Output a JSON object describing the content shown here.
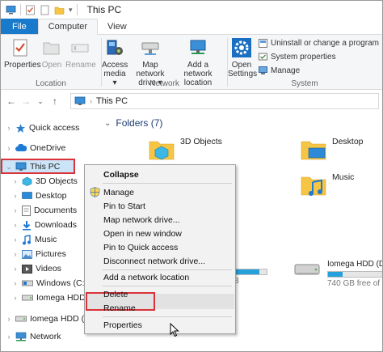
{
  "window": {
    "title": "This PC"
  },
  "tabs": [
    {
      "label": "File"
    },
    {
      "label": "Computer"
    },
    {
      "label": "View"
    }
  ],
  "ribbon": {
    "location": {
      "label": "Location",
      "buttons": [
        {
          "label": "Properties",
          "icon": "properties-icon"
        },
        {
          "label": "Open",
          "icon": "open-icon"
        },
        {
          "label": "Rename",
          "icon": "rename-icon"
        }
      ]
    },
    "network": {
      "label": "Network",
      "buttons": [
        {
          "line1": "Access",
          "line2": "media ▾",
          "icon": "access-media-icon"
        },
        {
          "line1": "Map network",
          "line2": "drive ▾",
          "icon": "map-network-drive-icon"
        },
        {
          "line1": "Add a network",
          "line2": "location",
          "icon": "add-network-location-icon"
        }
      ]
    },
    "system": {
      "label": "System",
      "open_settings": {
        "line1": "Open",
        "line2": "Settings"
      },
      "items": [
        {
          "label": "Uninstall or change a program"
        },
        {
          "label": "System properties"
        },
        {
          "label": "Manage"
        }
      ]
    }
  },
  "address": {
    "path": "This PC"
  },
  "nav": {
    "items": [
      {
        "label": "Quick access"
      },
      {
        "label": "OneDrive"
      },
      {
        "label": "This PC"
      },
      {
        "label": "3D Objects"
      },
      {
        "label": "Desktop"
      },
      {
        "label": "Documents"
      },
      {
        "label": "Downloads"
      },
      {
        "label": "Music"
      },
      {
        "label": "Pictures"
      },
      {
        "label": "Videos"
      },
      {
        "label": "Windows (C:)"
      },
      {
        "label": "Iomega HDD (D:"
      },
      {
        "label": "Iomega HDD (D:"
      },
      {
        "label": "Network"
      }
    ]
  },
  "content": {
    "folders_header": "Folders (7)",
    "folders": [
      {
        "label": "3D Objects"
      },
      {
        "label": "Desktop"
      },
      {
        "label": "Music"
      }
    ],
    "drive_left_tail": "TB",
    "drive": {
      "name": "Iomega HDD (D:",
      "free": "740 GB free of 93",
      "used_fraction": 0.2
    }
  },
  "context_menu": {
    "items": [
      {
        "label": "Collapse"
      },
      {
        "label": "Manage"
      },
      {
        "label": "Pin to Start"
      },
      {
        "label": "Map network drive..."
      },
      {
        "label": "Open in new window"
      },
      {
        "label": "Pin to Quick access"
      },
      {
        "label": "Disconnect network drive..."
      },
      {
        "label": "Add a network location"
      },
      {
        "label": "Delete"
      },
      {
        "label": "Rename"
      },
      {
        "label": "Properties"
      }
    ]
  },
  "colors": {
    "accent": "#1979ca",
    "highlight": "#d9323a",
    "folder": "#f6c544",
    "selection": "#cce4f7"
  }
}
